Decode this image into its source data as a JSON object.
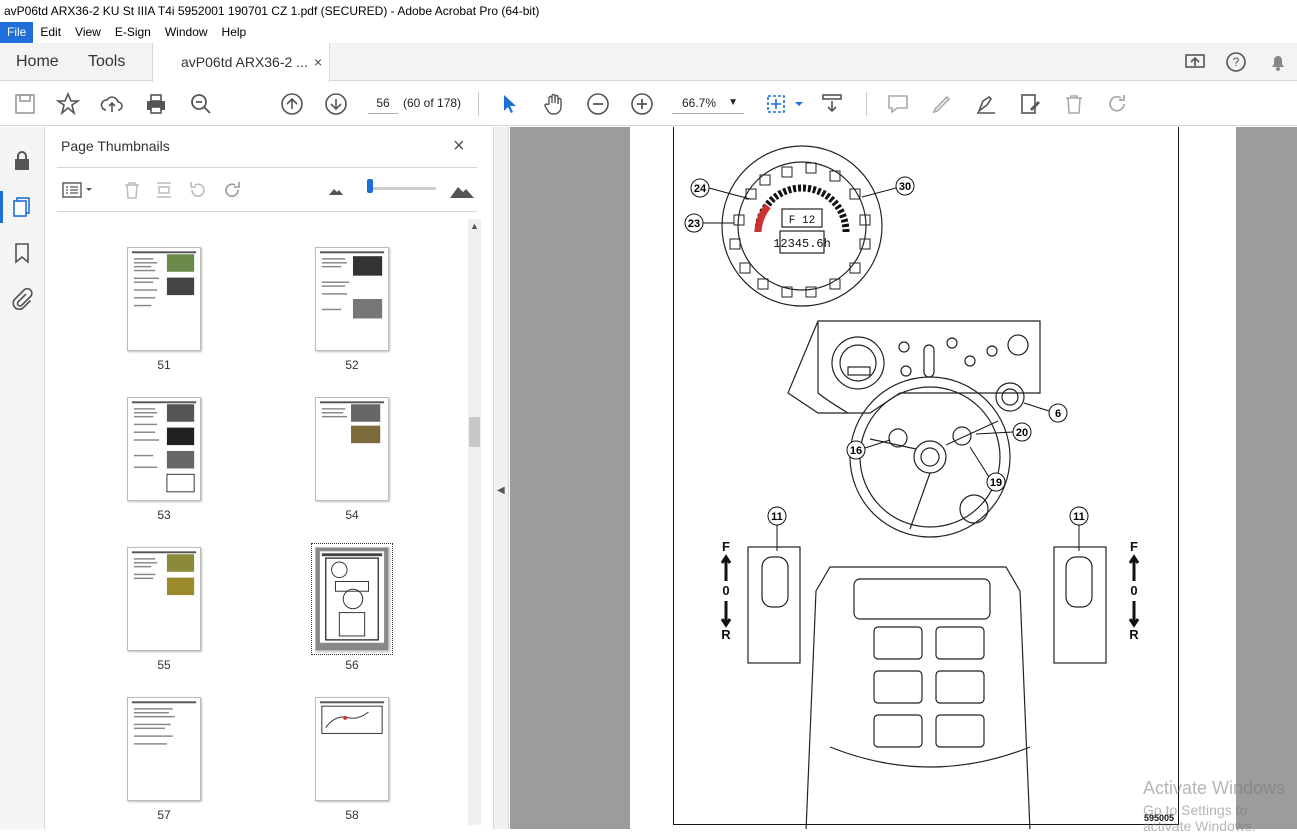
{
  "window": {
    "title": "avP06td ARX36-2 KU St IIIA T4i 5952001 190701 CZ 1.pdf (SECURED) - Adobe Acrobat Pro (64-bit)"
  },
  "menu": [
    "File",
    "Edit",
    "View",
    "E-Sign",
    "Window",
    "Help"
  ],
  "tabs": {
    "home": "Home",
    "tools": "Tools",
    "document": "avP06td ARX36-2 ...",
    "close": "×"
  },
  "toolbar": {
    "current_page": "56",
    "page_count": "(60 of 178)",
    "zoom": "66.7%"
  },
  "panel": {
    "title": "Page Thumbnails",
    "close": "×"
  },
  "thumbnails": [
    {
      "label": "51"
    },
    {
      "label": "52"
    },
    {
      "label": "53"
    },
    {
      "label": "54"
    },
    {
      "label": "55"
    },
    {
      "label": "56",
      "selected": true
    },
    {
      "label": "57"
    },
    {
      "label": "58"
    }
  ],
  "document": {
    "callouts": [
      "24",
      "30",
      "23",
      "6",
      "20",
      "16",
      "19",
      "11",
      "11"
    ],
    "display_gear": "F 12",
    "display_hours": "12345.6h",
    "lever_labels": [
      "F",
      "0",
      "R"
    ],
    "figure_id": "595005"
  },
  "watermark": {
    "line1": "Activate Windows",
    "line2": "Go to Settings to activate Windows."
  },
  "colors": {
    "accent": "#1e6fd9",
    "viewer_bg": "#9c9c9c"
  }
}
